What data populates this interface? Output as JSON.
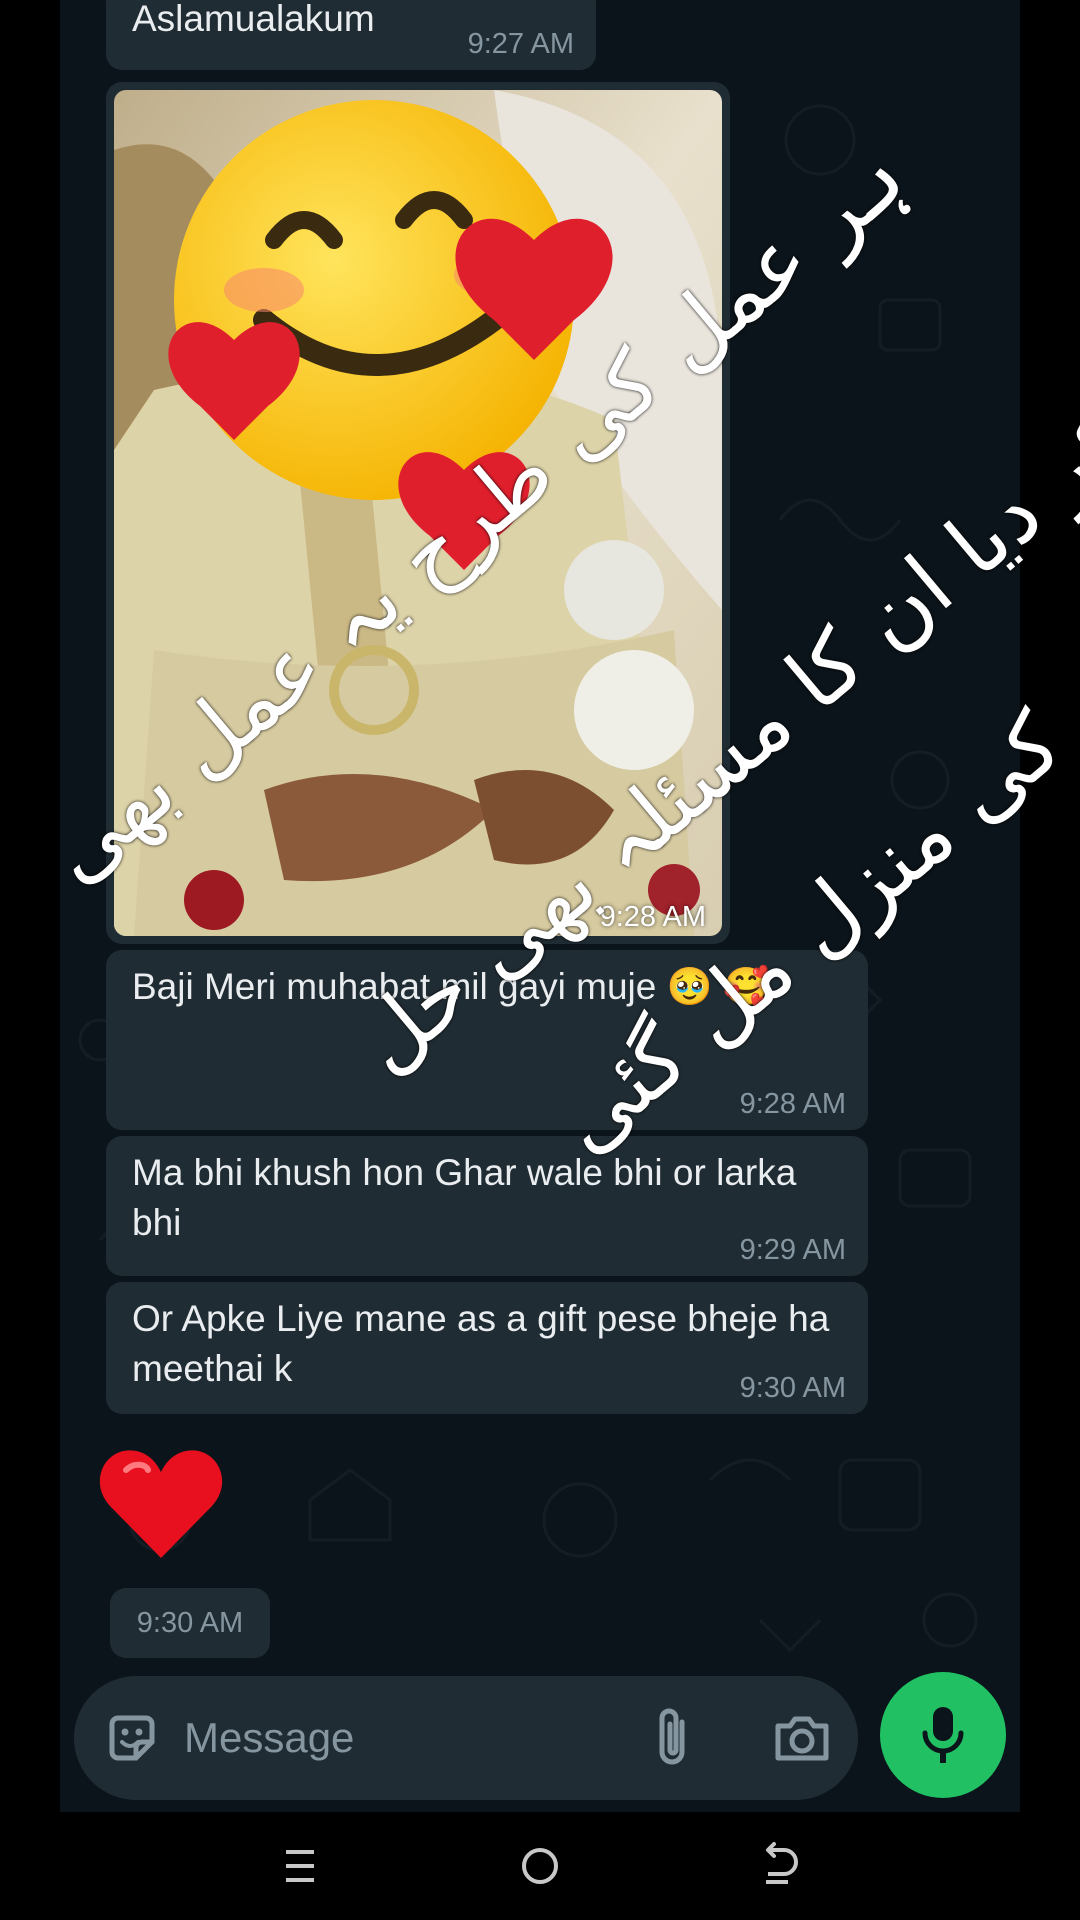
{
  "messages": [
    {
      "text": "Aslamualakum",
      "time": "9:27 AM"
    },
    {
      "image": "photo",
      "time": "9:28 AM"
    },
    {
      "text": "Baji Meri muhabat mil gayi muje 🥹 🥰",
      "time": "9:28 AM"
    },
    {
      "text": "Ma bhi khush hon Ghar wale bhi or larka bhi",
      "time": "9:29 AM"
    },
    {
      "text": "Or Apke Liye mane as a gift pese bheje ha meethai k",
      "time": "9:30 AM"
    },
    {
      "emoji": "❤️",
      "time": "9:30 AM"
    }
  ],
  "composer": {
    "placeholder": "Message"
  },
  "overlay": {
    "lines": [
      "ہر عمل کی طرح یہ عمل بھی",
      "پورا کر دیا ان کا مسئلہ بھی حل",
      "کر دیا ان کو ان کی منزل مل گئی"
    ]
  },
  "colors": {
    "background": "#0b141a",
    "bubble": "#202c33",
    "text": "#e9edef",
    "meta": "#8696a0",
    "accent": "#21c063"
  },
  "icons": [
    "sticker-icon",
    "attach-icon",
    "camera-icon",
    "mic-icon",
    "recents-icon",
    "home-icon",
    "back-icon"
  ]
}
